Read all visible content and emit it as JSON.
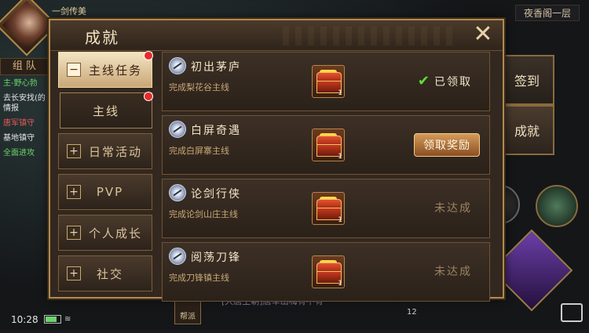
{
  "hud": {
    "top_name": "一剑传美",
    "team_tab": "组 队",
    "quests": [
      {
        "text": "主-野心勃",
        "color": "green"
      },
      {
        "text": "去长安找(的情报",
        "color": "white"
      },
      {
        "text": "唐军镇守",
        "color": "red"
      },
      {
        "text": "基地镇守",
        "color": "white"
      },
      {
        "text": "全面进攻",
        "color": "green"
      }
    ],
    "time": "10:28",
    "map_label": "夜香阁一层",
    "bottom_chat": "[大唐王朝]唐军出嗨有不有",
    "guild_label": "帮派",
    "bottom_number": "12"
  },
  "side_buttons": {
    "checkin": "签到",
    "achievement": "成就"
  },
  "panel": {
    "title": "成就",
    "close_label": "✕"
  },
  "nav": {
    "main_quest": {
      "sign": "−",
      "label": "主线任务"
    },
    "sub_main": {
      "label": "主线"
    },
    "daily": {
      "sign": "+",
      "label": "日常活动"
    },
    "pvp": {
      "sign": "+",
      "label": "PVP"
    },
    "growth": {
      "sign": "+",
      "label": "个人成长"
    },
    "social": {
      "sign": "+",
      "label": "社交"
    }
  },
  "achievements": [
    {
      "title": "初出茅庐",
      "desc": "完成梨花谷主线",
      "reward_count": "1",
      "status": "已领取",
      "state": "claimed"
    },
    {
      "title": "白屏奇遇",
      "desc": "完成白屏寨主线",
      "reward_count": "1",
      "status": "领取奖励",
      "state": "claimable"
    },
    {
      "title": "论剑行侠",
      "desc": "完成论剑山庄主线",
      "reward_count": "1",
      "status": "未达成",
      "state": "pending"
    },
    {
      "title": "阅荡刀锋",
      "desc": "完成刀锋镇主线",
      "reward_count": "1",
      "status": "未达成",
      "state": "pending"
    }
  ],
  "colors": {
    "panel_border": "#b08a50",
    "active_tab": "#f3e4c4",
    "claim_button": "#d39a5a",
    "check_green": "#5fdc3a",
    "red_dot": "#e62c2c"
  },
  "icons": [
    "close-icon",
    "check-icon",
    "treasure-chest-icon",
    "sword-emblem-icon",
    "plus-icon",
    "minus-icon"
  ]
}
